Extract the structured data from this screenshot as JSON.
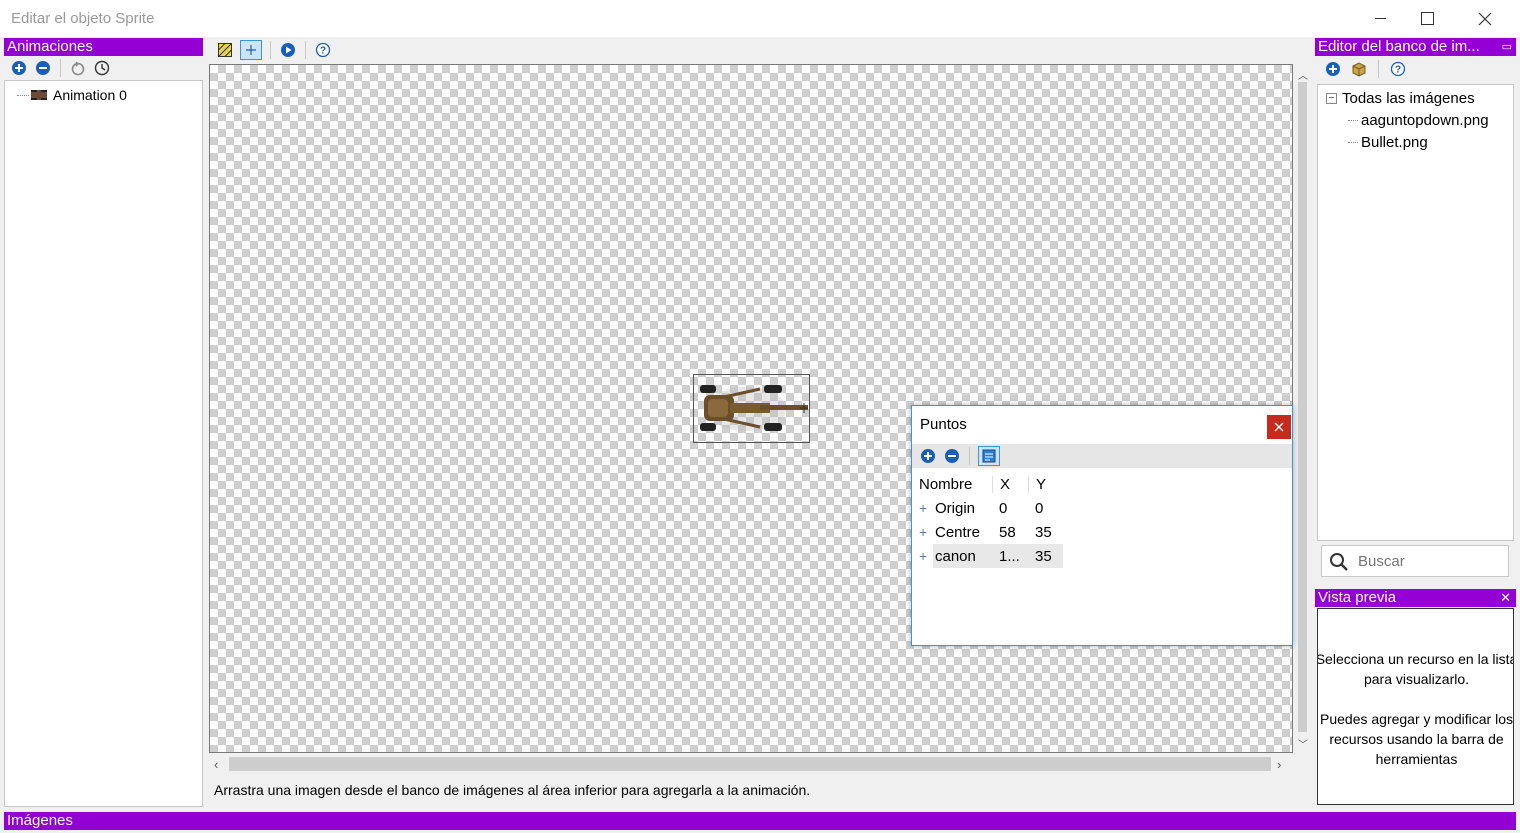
{
  "window": {
    "title": "Editar el objeto Sprite"
  },
  "animations": {
    "header": "Animaciones",
    "items": [
      {
        "label": "Animation 0"
      }
    ]
  },
  "canvas": {
    "hint": "Arrastra una imagen desde el banco de imágenes al área inferior para agregarla a la animación."
  },
  "points_dialog": {
    "title": "Puntos",
    "columns": {
      "name": "Nombre",
      "x": "X",
      "y": "Y"
    },
    "rows": [
      {
        "name": "Origin",
        "x": "0",
        "y": "0"
      },
      {
        "name": "Centre",
        "x": "58",
        "y": "35"
      },
      {
        "name": "canon",
        "x": "1...",
        "y": "35"
      }
    ]
  },
  "image_bank": {
    "header": "Editor del banco de im...",
    "tree": {
      "root": "Todas las imágenes",
      "children": [
        "aaguntopdown.png",
        "Bullet.png"
      ]
    },
    "search_placeholder": "Buscar"
  },
  "preview": {
    "header": "Vista previa",
    "line1": "Selecciona un recurso en la lista para visualizarlo.",
    "line2": "Puedes agregar y modificar los recursos usando la barra de herramientas"
  },
  "bottom": {
    "header": "Imágenes"
  },
  "colors": {
    "accent": "#9400d3",
    "close_red": "#c42b1c"
  }
}
